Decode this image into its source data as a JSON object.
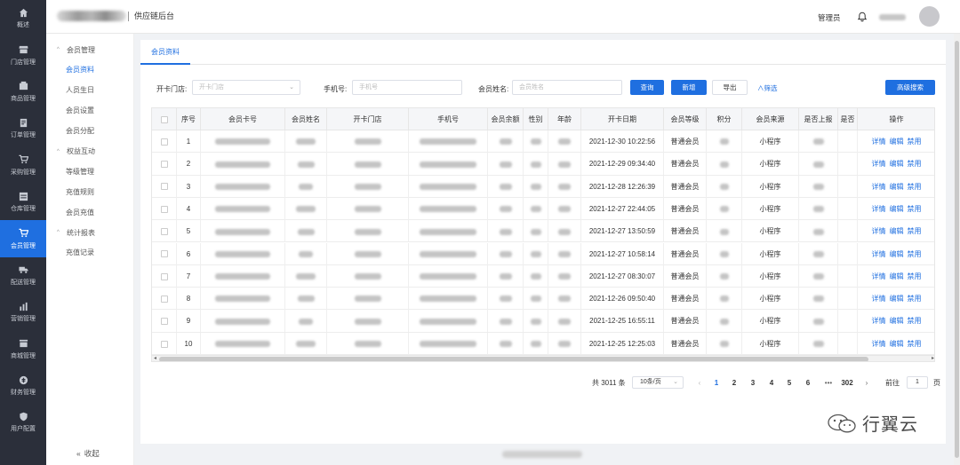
{
  "nav": [
    {
      "icon": "home-icon",
      "label": "概述"
    },
    {
      "icon": "store-icon",
      "label": "门店管理"
    },
    {
      "icon": "product-icon",
      "label": "商品管理"
    },
    {
      "icon": "order-icon",
      "label": "订单管理"
    },
    {
      "icon": "cart-icon",
      "label": "采购管理"
    },
    {
      "icon": "warehouse-icon",
      "label": "仓库管理"
    },
    {
      "icon": "member-cart-icon",
      "label": "会员管理",
      "active": true
    },
    {
      "icon": "truck-icon",
      "label": "配送管理"
    },
    {
      "icon": "chart-icon",
      "label": "营销管理"
    },
    {
      "icon": "mall-icon",
      "label": "商城管理"
    },
    {
      "icon": "finance-icon",
      "label": "财务管理"
    },
    {
      "icon": "shield-icon",
      "label": "用户配置"
    }
  ],
  "header": {
    "system_title": "供应链后台",
    "admin_label": "管理员"
  },
  "submenu": {
    "groups": [
      {
        "label": "会员管理",
        "items": [
          "会员资料",
          "人员生日",
          "会员设置",
          "会员分配"
        ]
      },
      {
        "label": "权益互动",
        "items": [
          "等级管理",
          "充值规则",
          "会员充值"
        ]
      },
      {
        "label": "统计报表",
        "items": [
          "充值记录"
        ]
      }
    ],
    "active_item": "会员资料",
    "collapse_label": "收起"
  },
  "tab": {
    "label": "会员资料"
  },
  "filters": {
    "store_label": "开卡门店:",
    "store_placeholder": "开卡门店",
    "phone_label": "手机号:",
    "phone_placeholder": "手机号",
    "name_label": "会员姓名:",
    "name_placeholder": "会员姓名",
    "query_button": "查询",
    "new_button": "新增",
    "export_button": "导出",
    "filter_toggle": "∧筛选",
    "advanced_button": "高级搜索"
  },
  "table": {
    "headers": [
      "序号",
      "会员卡号",
      "会员姓名",
      "开卡门店",
      "手机号",
      "会员余额",
      "性别",
      "年龄",
      "开卡日期",
      "会员等级",
      "积分",
      "会员来源",
      "是否上报",
      "是否",
      "操作"
    ],
    "rows": [
      {
        "no": "1",
        "date": "2021-12-30 10:22:56",
        "level": "普通会员",
        "source": "小程序"
      },
      {
        "no": "2",
        "date": "2021-12-29 09:34:40",
        "level": "普通会员",
        "source": "小程序"
      },
      {
        "no": "3",
        "date": "2021-12-28 12:26:39",
        "level": "普通会员",
        "source": "小程序"
      },
      {
        "no": "4",
        "date": "2021-12-27 22:44:05",
        "level": "普通会员",
        "source": "小程序"
      },
      {
        "no": "5",
        "date": "2021-12-27 13:50:59",
        "level": "普通会员",
        "source": "小程序"
      },
      {
        "no": "6",
        "date": "2021-12-27 10:58:14",
        "level": "普通会员",
        "source": "小程序"
      },
      {
        "no": "7",
        "date": "2021-12-27 08:30:07",
        "level": "普通会员",
        "source": "小程序"
      },
      {
        "no": "8",
        "date": "2021-12-26 09:50:40",
        "level": "普通会员",
        "source": "小程序"
      },
      {
        "no": "9",
        "date": "2021-12-25 16:55:11",
        "level": "普通会员",
        "source": "小程序"
      },
      {
        "no": "10",
        "date": "2021-12-25 12:25:03",
        "level": "普通会员",
        "source": "小程序"
      }
    ],
    "actions": {
      "detail": "详情",
      "edit": "编辑",
      "disable": "禁用"
    }
  },
  "pagination": {
    "total": "共 3011 条",
    "page_size": "10条/页",
    "pages": [
      "1",
      "2",
      "3",
      "4",
      "5",
      "6"
    ],
    "ellipsis": "•••",
    "last_page": "302",
    "current": "1",
    "goto_label": "前往",
    "goto_value": "1",
    "page_suffix": "页",
    "prev": "‹",
    "next": "›"
  },
  "watermark": {
    "text": "行翼云"
  },
  "colors": {
    "accent": "#1f6fe0",
    "nav_bg": "#2b2f3a"
  }
}
